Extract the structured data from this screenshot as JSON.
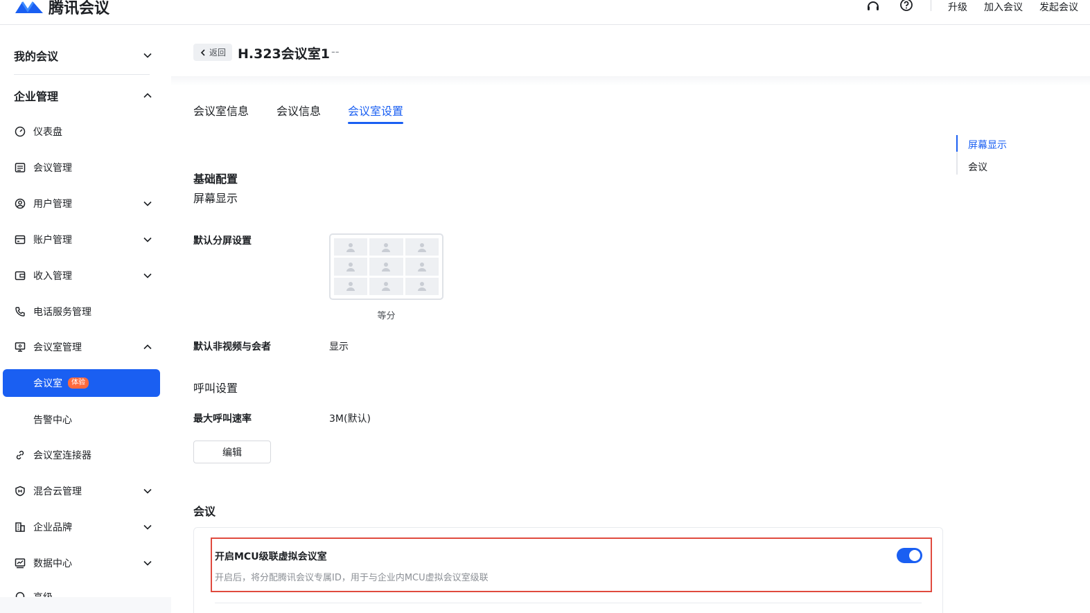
{
  "app": {
    "name": "腾讯会议"
  },
  "topbar": {
    "upgrade": "升级",
    "join": "加入会议",
    "start": "发起会议"
  },
  "sidebar": {
    "my_meetings": "我的会议",
    "enterprise": "企业管理",
    "items": {
      "dashboard": "仪表盘",
      "meeting_mgmt": "会议管理",
      "user_mgmt": "用户管理",
      "account_mgmt": "账户管理",
      "income_mgmt": "收入管理",
      "phone_service": "电话服务管理",
      "room_mgmt": "会议室管理",
      "room": "会议室",
      "room_badge": "体验",
      "alarm_center": "告警中心",
      "room_connector": "会议室连接器",
      "hybrid_cloud": "混合云管理",
      "brand": "企业品牌",
      "data_center": "数据中心",
      "advanced": "高级"
    }
  },
  "header": {
    "back": "返回",
    "title": "H.323会议室1",
    "suffix": "--"
  },
  "tabs": [
    "会议室信息",
    "会议信息",
    "会议室设置"
  ],
  "anchors": [
    "屏幕显示",
    "会议"
  ],
  "content": {
    "basic_config": "基础配置",
    "screen_display": "屏幕显示",
    "default_split_label": "默认分屏设置",
    "split_caption": "等分",
    "non_video_label": "默认非视频与会者",
    "non_video_value": "显示",
    "call_settings": "呼叫设置",
    "max_rate_label": "最大呼叫速率",
    "max_rate_value": "3M(默认)",
    "edit": "编辑",
    "meeting_section": "会议",
    "mcu_title": "开启MCU级联虚拟会议室",
    "mcu_desc": "开启后，将分配腾讯会议专属ID，用于与企业内MCU虚拟会议室级联",
    "mcu_enabled": true
  },
  "colors": {
    "accent": "#1a5ff2",
    "badge": "#ff6a3d",
    "highlight": "#e04a3e"
  }
}
